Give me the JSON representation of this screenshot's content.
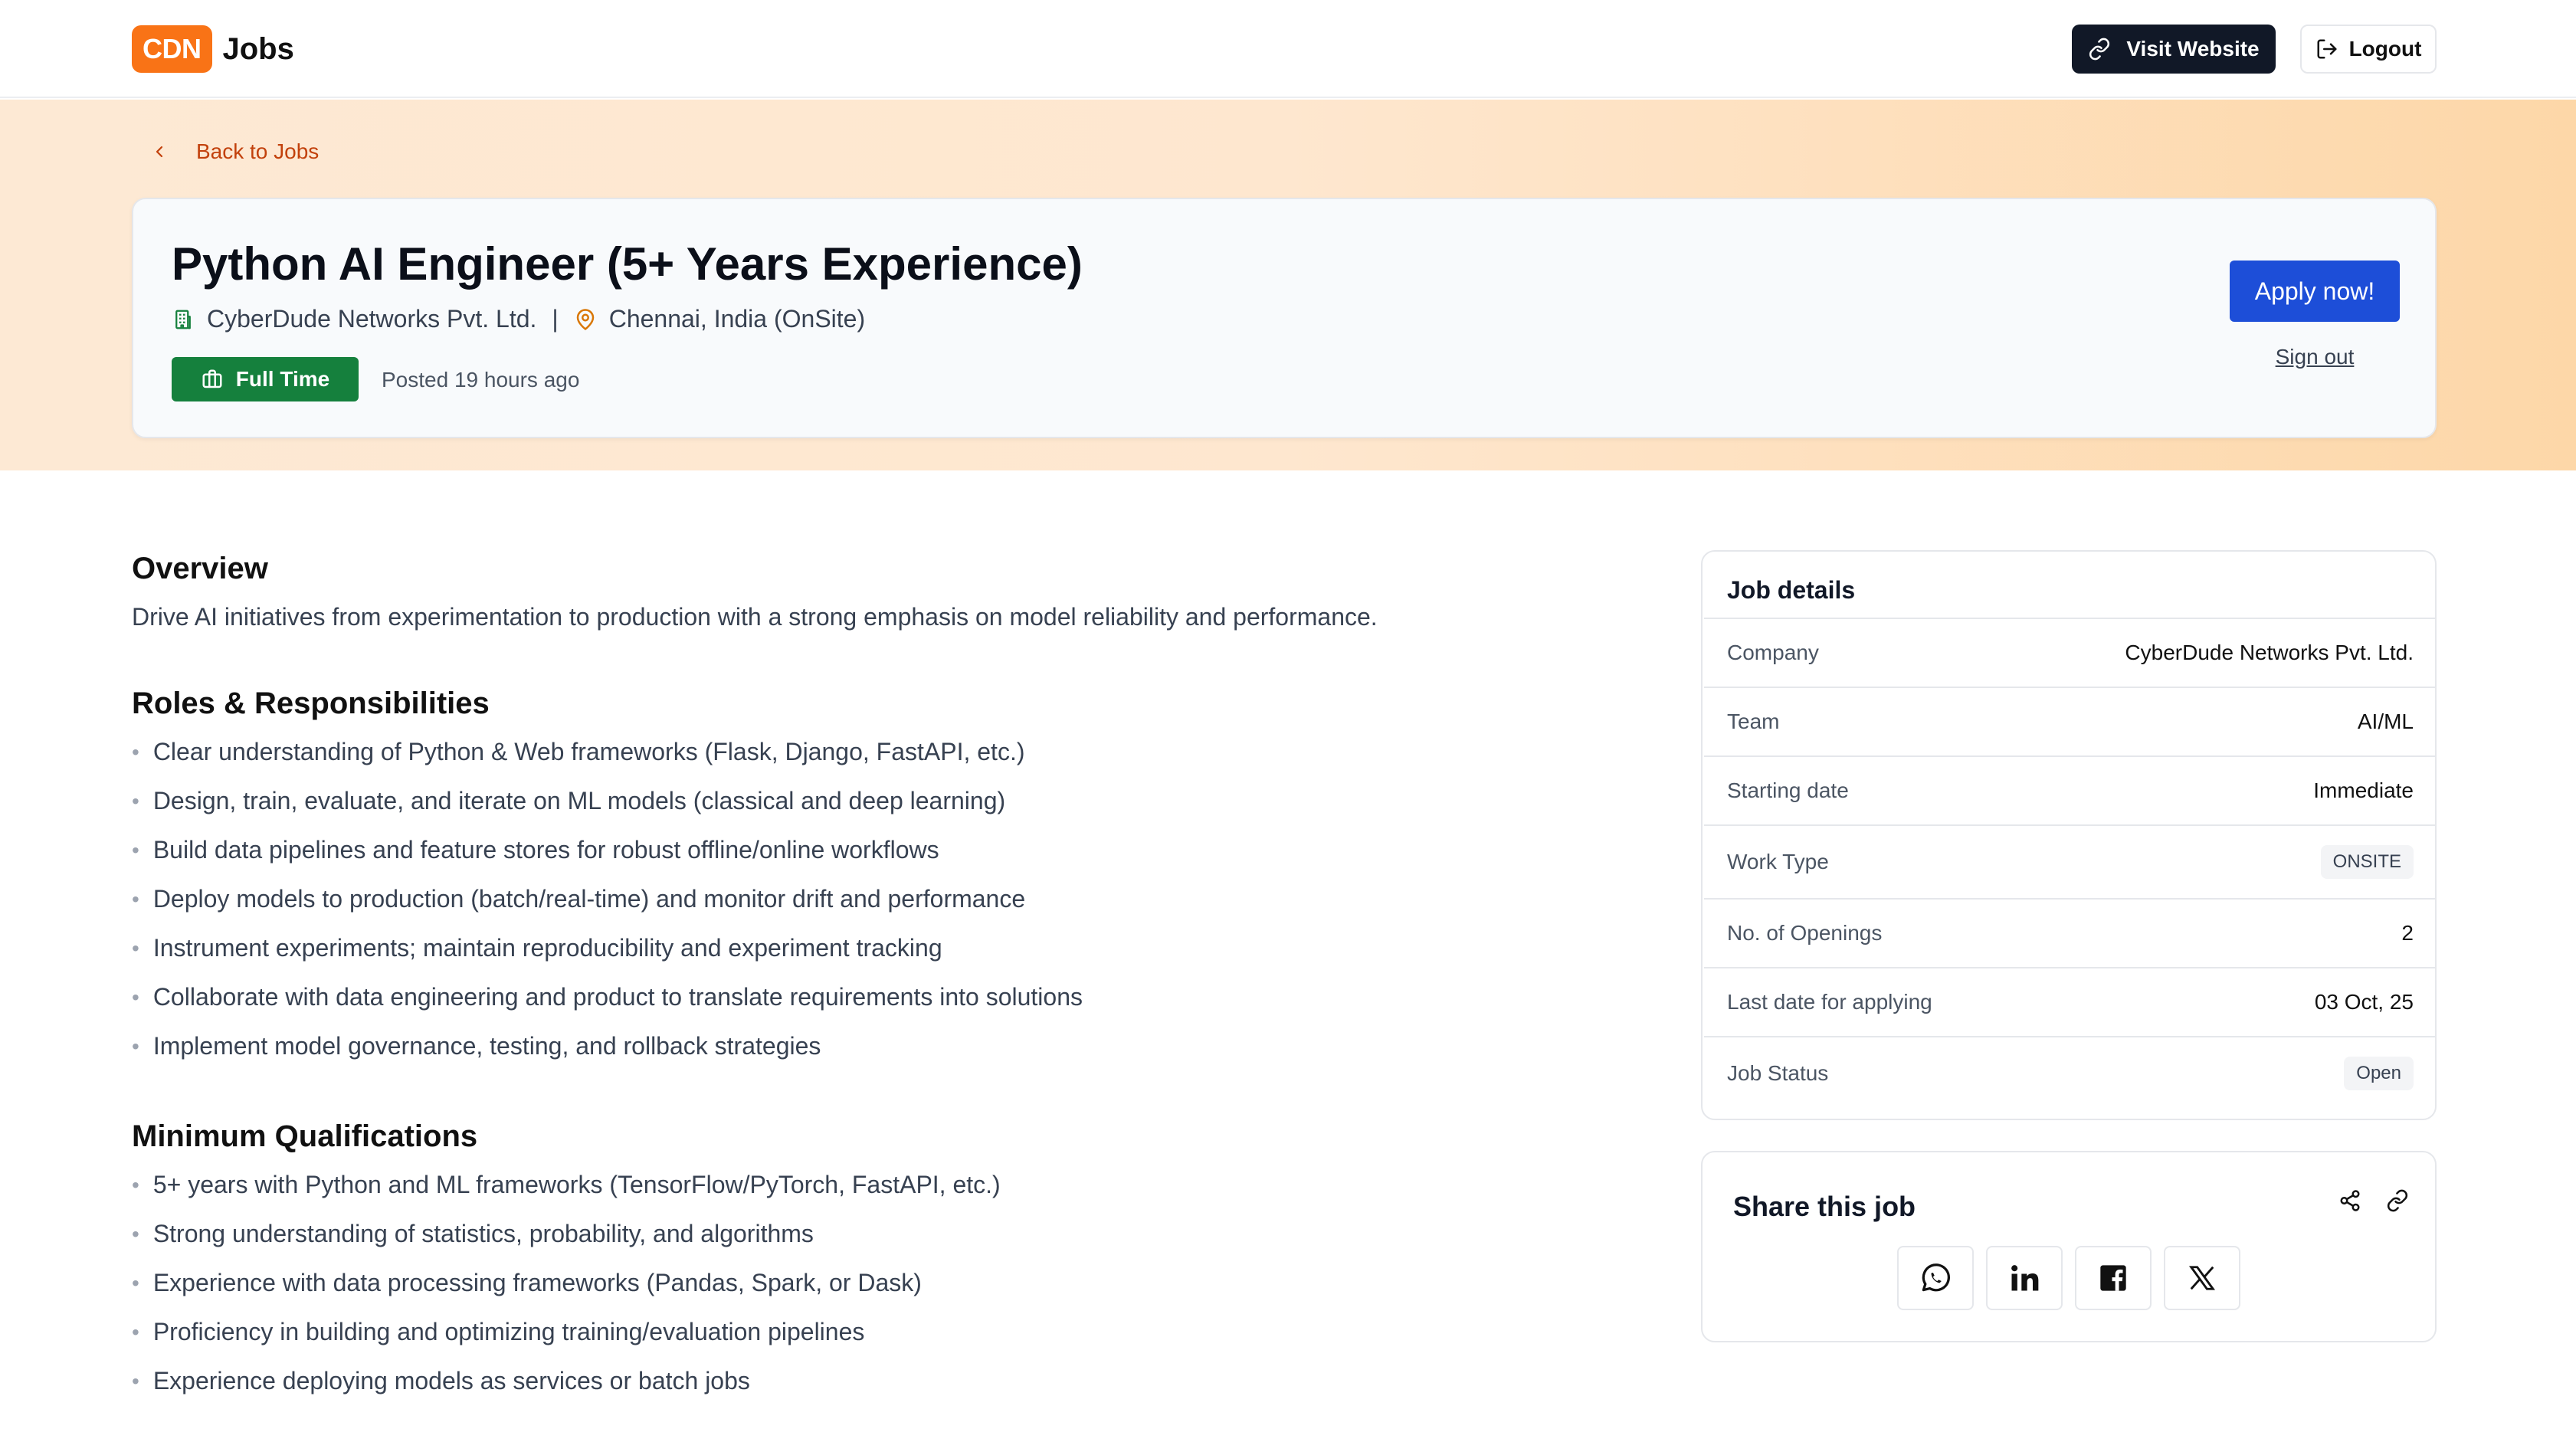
{
  "header": {
    "logo_badge": "CDN",
    "logo_text": "Jobs",
    "visit_label": "Visit Website",
    "logout_label": "Logout"
  },
  "hero": {
    "back_label": "Back to Jobs",
    "title": "Python AI Engineer (5+ Years Experience)",
    "company": "CyberDude Networks Pvt. Ltd.",
    "separator": "|",
    "location": "Chennai, India (OnSite)",
    "job_type": "Full Time",
    "posted": "Posted 19 hours ago",
    "apply_label": "Apply now!",
    "signout_label": "Sign out"
  },
  "overview": {
    "heading": "Overview",
    "text": "Drive AI initiatives from experimentation to production with a strong emphasis on model reliability and performance."
  },
  "roles": {
    "heading": "Roles & Responsibilities",
    "items": [
      "Clear understanding of Python & Web frameworks (Flask, Django, FastAPI, etc.)",
      "Design, train, evaluate, and iterate on ML models (classical and deep learning)",
      "Build data pipelines and feature stores for robust offline/online workflows",
      "Deploy models to production (batch/real-time) and monitor drift and performance",
      "Instrument experiments; maintain reproducibility and experiment tracking",
      "Collaborate with data engineering and product to translate requirements into solutions",
      "Implement model governance, testing, and rollback strategies"
    ]
  },
  "qualifications": {
    "heading": "Minimum Qualifications",
    "items": [
      "5+ years with Python and ML frameworks (TensorFlow/PyTorch, FastAPI, etc.)",
      "Strong understanding of statistics, probability, and algorithms",
      "Experience with data processing frameworks (Pandas, Spark, or Dask)",
      "Proficiency in building and optimizing training/evaluation pipelines",
      "Experience deploying models as services or batch jobs"
    ]
  },
  "details": {
    "title": "Job details",
    "rows": [
      {
        "label": "Company",
        "value": "CyberDude Networks Pvt. Ltd."
      },
      {
        "label": "Team",
        "value": "AI/ML"
      },
      {
        "label": "Starting date",
        "value": "Immediate"
      },
      {
        "label": "Work Type",
        "value": "ONSITE"
      },
      {
        "label": "No. of Openings",
        "value": "2"
      },
      {
        "label": "Last date for applying",
        "value": "03 Oct, 25"
      },
      {
        "label": "Job Status",
        "value": "Open"
      }
    ]
  },
  "share": {
    "title": "Share this job",
    "networks": [
      "whatsapp-icon",
      "linkedin-icon",
      "facebook-icon",
      "x-icon"
    ]
  },
  "colors": {
    "brand": "#f97316",
    "apply": "#1d4ed8",
    "full_time": "#15803d",
    "back_link": "#c2410c"
  }
}
